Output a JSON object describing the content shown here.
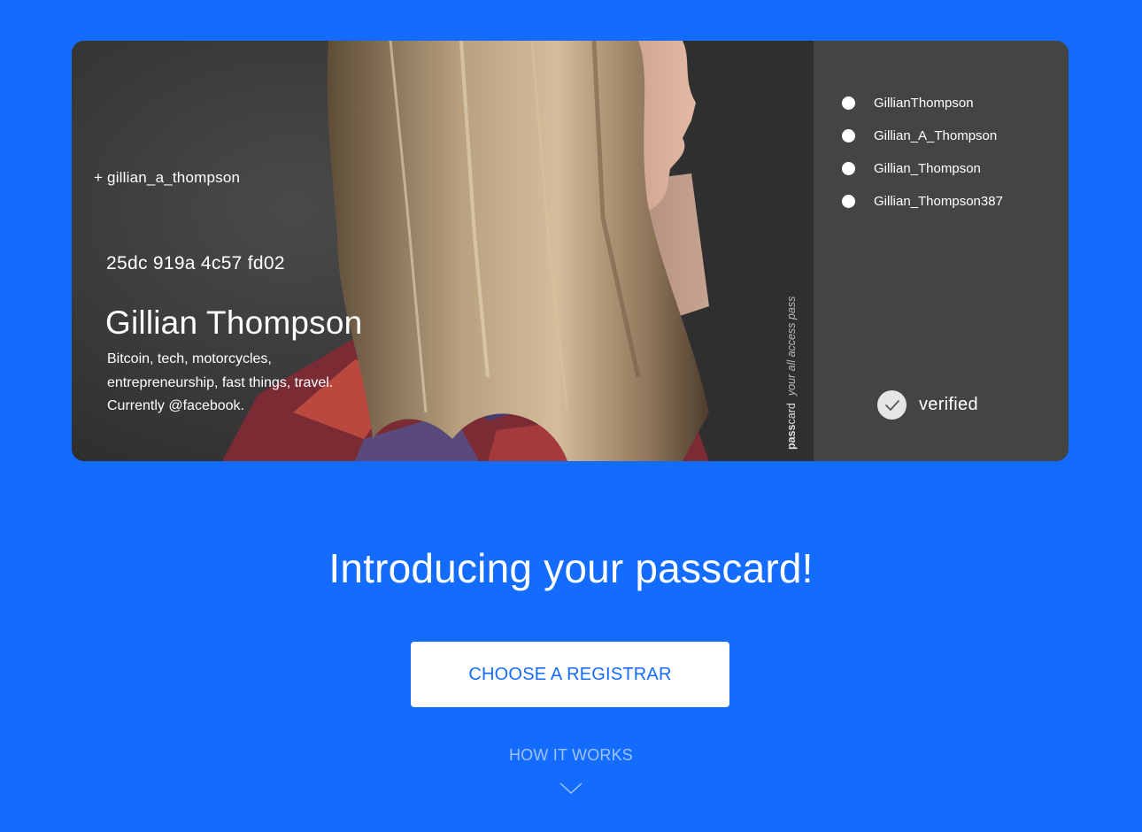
{
  "card": {
    "handle": "+ gillian_a_thompson",
    "key": "25dc 919a 4c57 fd02",
    "name": "Gillian Thompson",
    "bio": [
      "Bitcoin, tech, motorcycles,",
      "entrepreneurship, fast things, travel.",
      "Currently @facebook."
    ],
    "brand": {
      "pass": "pass",
      "card": "card",
      "tagline": "your all access pass"
    },
    "aliases": [
      "GillianThompson",
      "Gillian_A_Thompson",
      "Gillian_Thompson",
      "Gillian_Thompson387"
    ],
    "verified_label": "verified",
    "icons": {
      "verified": "checkmark-icon",
      "alias": "dot-icon"
    }
  },
  "headline": "Introducing your passcard!",
  "cta_label": "CHOOSE A REGISTRAR",
  "how_label": "HOW IT WORKS",
  "colors": {
    "background": "#136cfd",
    "button_text": "#136cfd",
    "link": "#9ec3ff"
  }
}
